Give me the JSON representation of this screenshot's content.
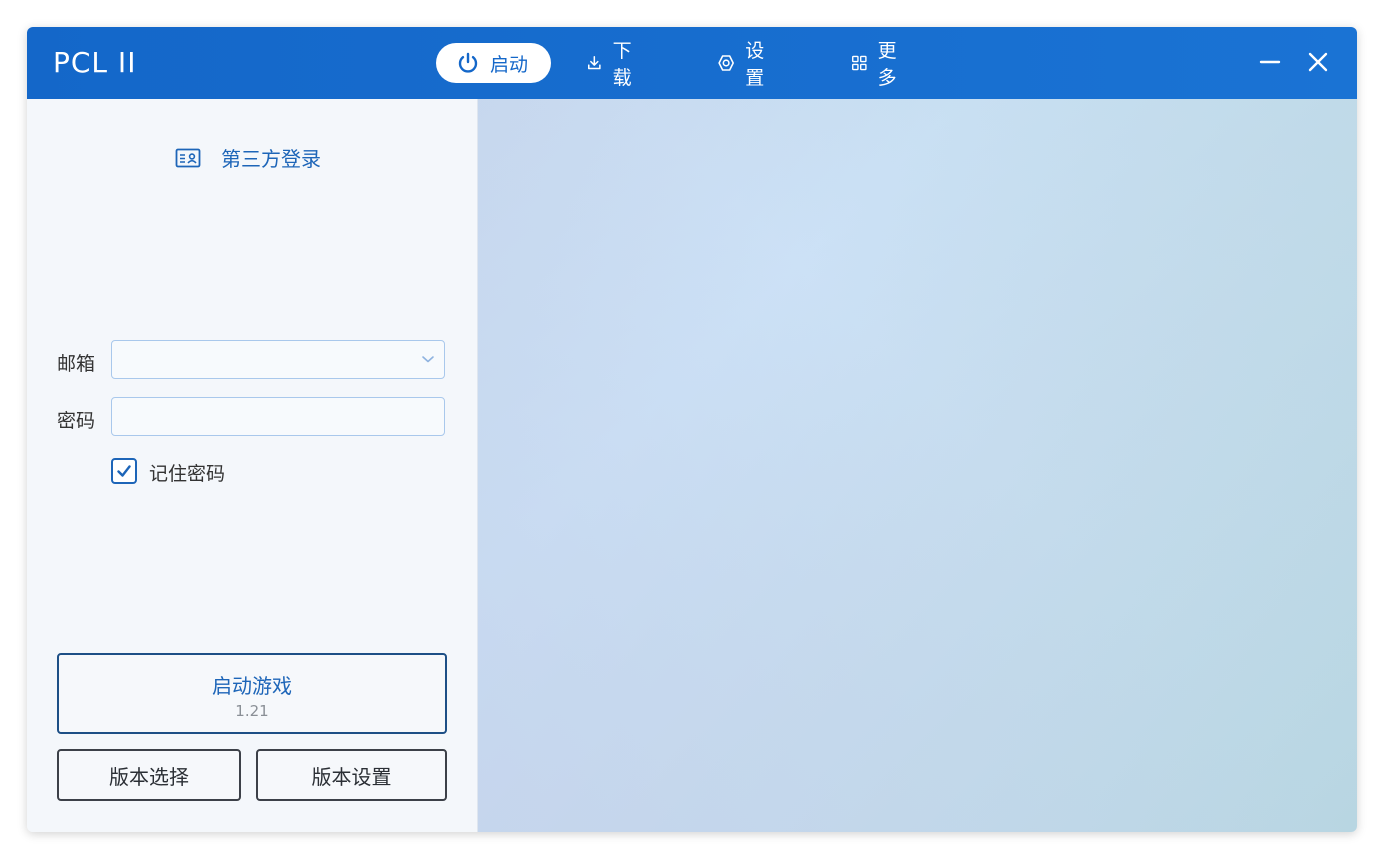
{
  "app": {
    "title": "PCL II"
  },
  "nav": {
    "items": [
      {
        "label": "启动",
        "icon": "power-icon",
        "active": true
      },
      {
        "label": "下载",
        "icon": "download-icon",
        "active": false
      },
      {
        "label": "设置",
        "icon": "gear-icon",
        "active": false
      },
      {
        "label": "更多",
        "icon": "grid-icon",
        "active": false
      }
    ]
  },
  "window_controls": {
    "minimize": "minimize-icon",
    "close": "close-icon"
  },
  "login": {
    "title": "第三方登录",
    "title_icon": "id-card-icon",
    "email_label": "邮箱",
    "email_value": "",
    "password_label": "密码",
    "password_value": "",
    "remember_label": "记住密码",
    "remember_checked": true
  },
  "launch": {
    "title": "启动游戏",
    "version": "1.21"
  },
  "version_buttons": {
    "select": "版本选择",
    "settings": "版本设置"
  },
  "colors": {
    "accent": "#1467c9",
    "text_accent": "#1d65b8"
  }
}
